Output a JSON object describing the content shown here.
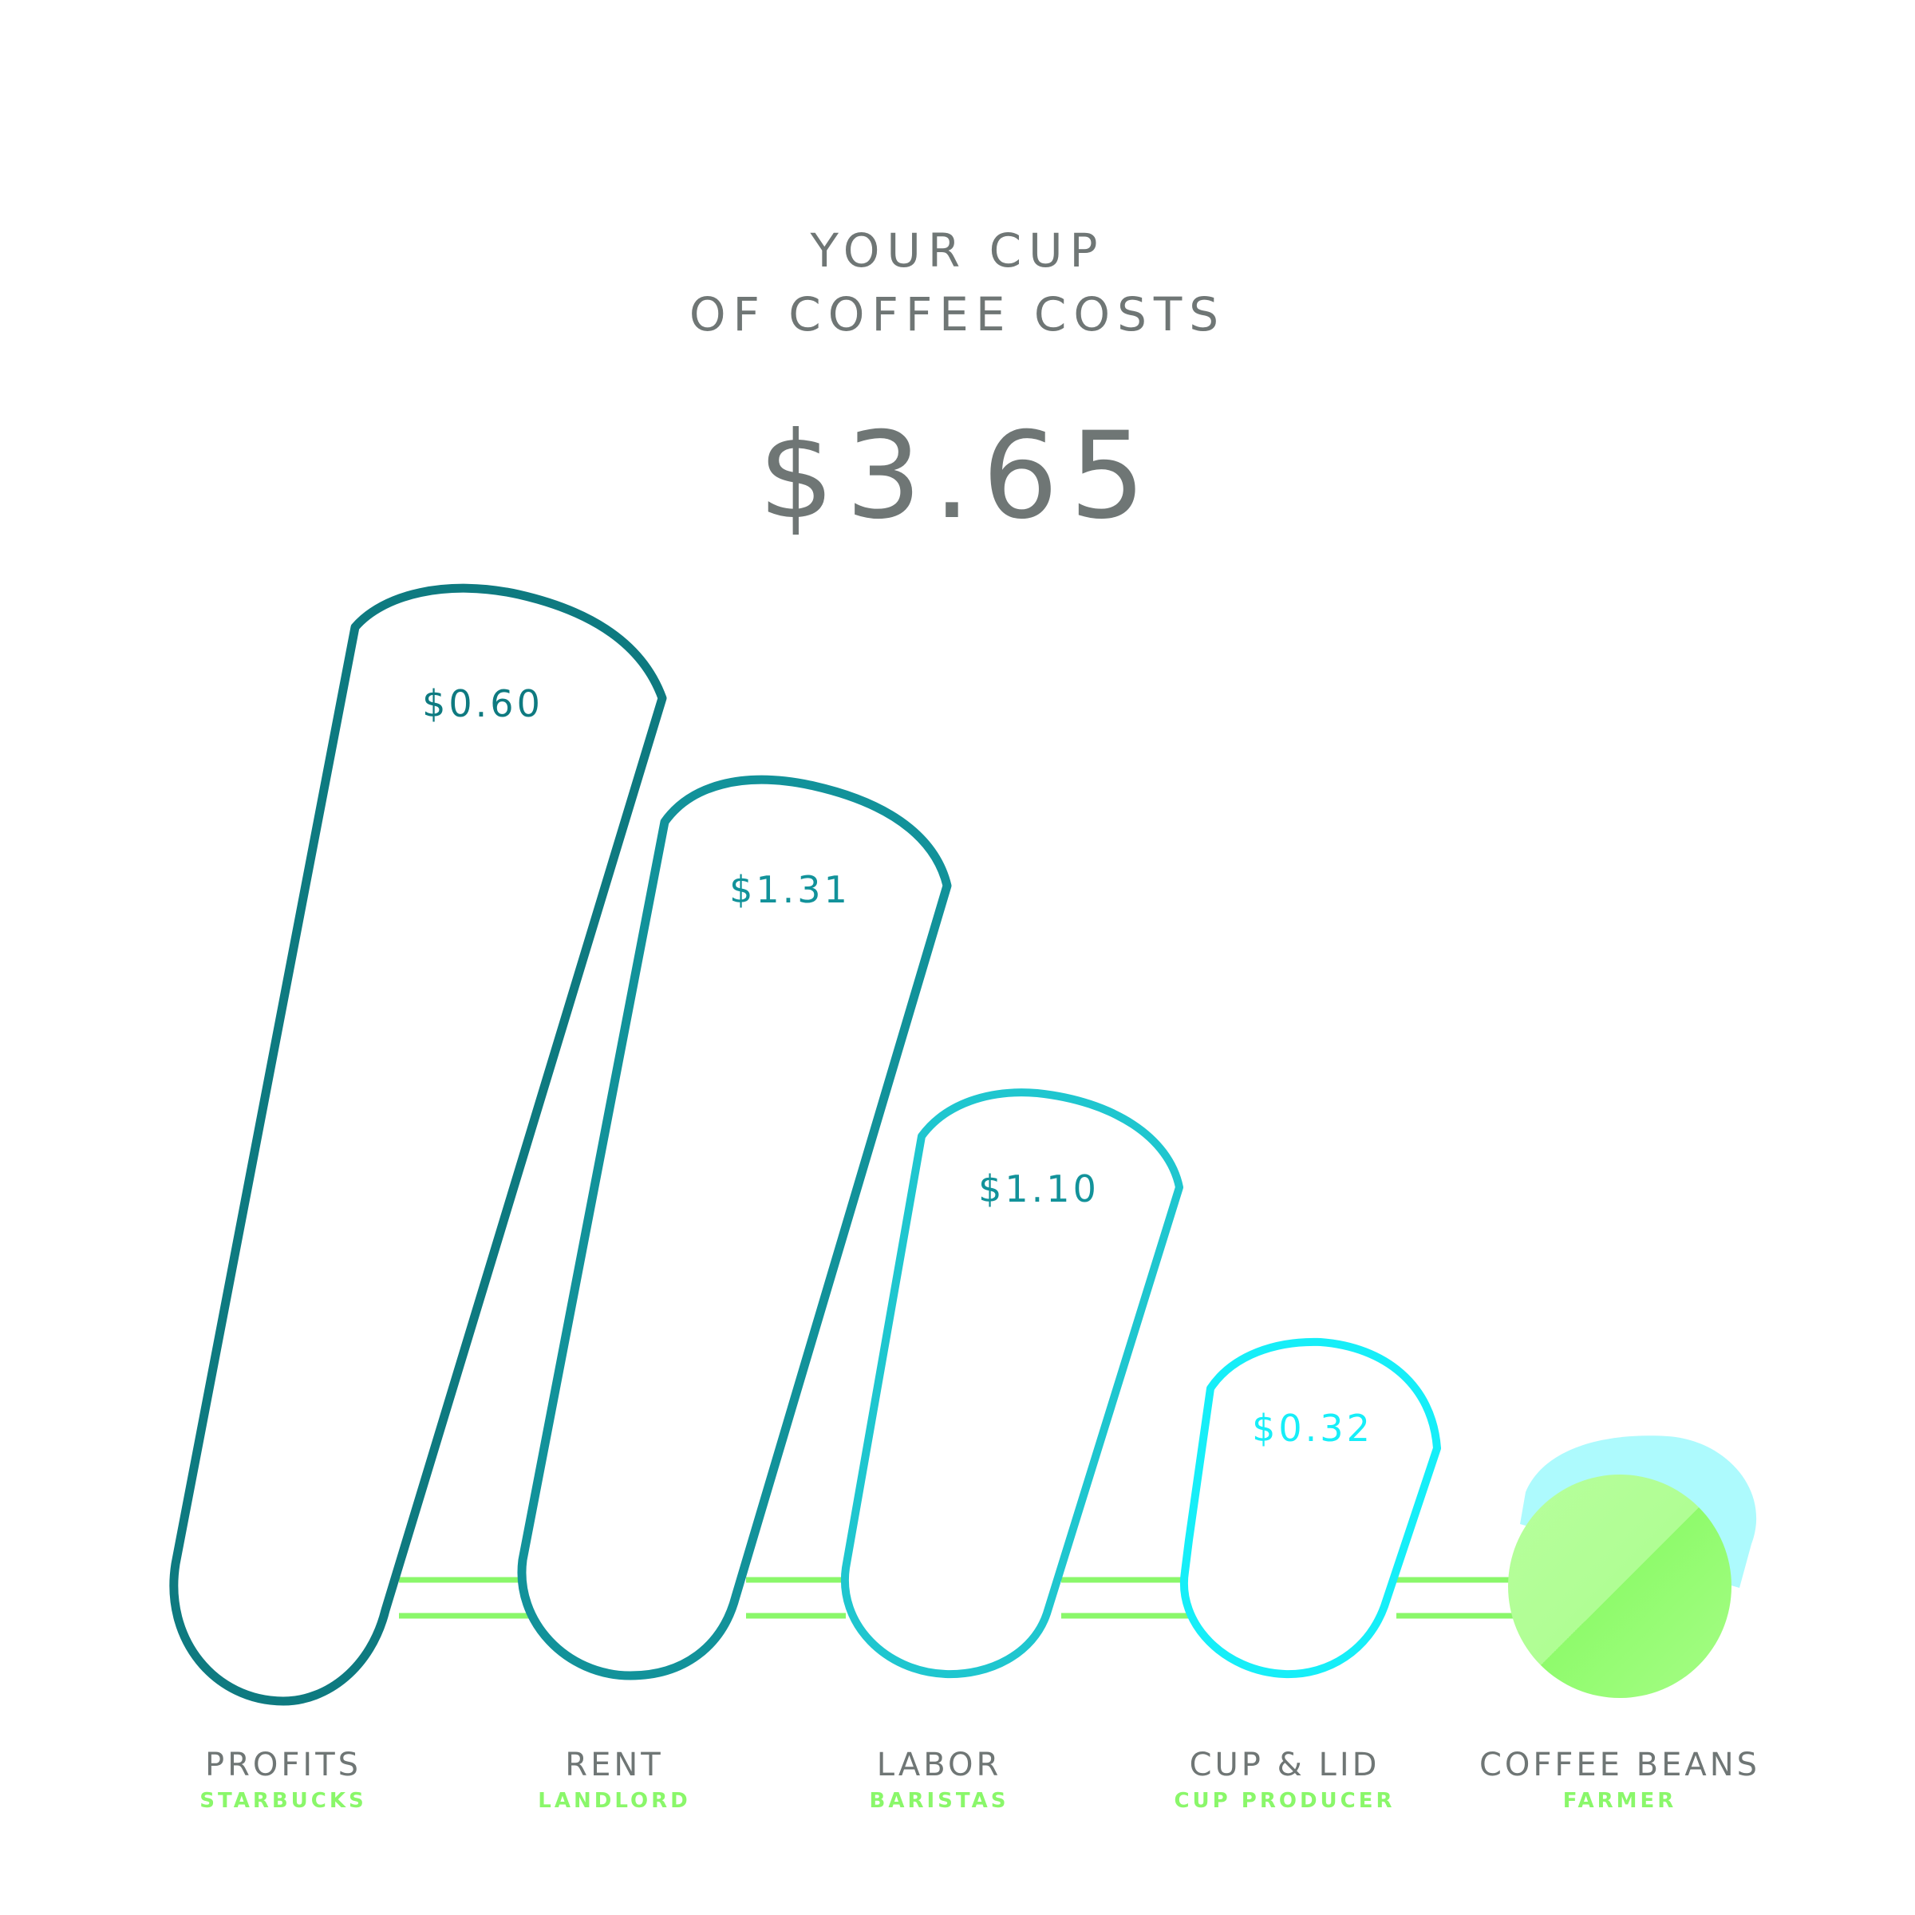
{
  "title_lines": [
    "YOUR CUP",
    "OF COFFEE COSTS"
  ],
  "total": "$3.65",
  "chart_data": {
    "type": "bar",
    "title": "YOUR CUP OF COFFEE COSTS",
    "total": 3.65,
    "categories": [
      "PROFITS",
      "RENT",
      "LABOR",
      "CUP & LID",
      "COFFEE BEANS"
    ],
    "subcategories": [
      "STARBUCKS",
      "LANDLORD",
      "BARISTAS",
      "CUP PRODUCER",
      "FARMER"
    ],
    "value_labels": [
      "$0.60",
      "$1.31",
      "$1.10",
      "$0.32",
      ""
    ],
    "values": [
      0.6,
      1.31,
      1.1,
      0.32,
      null
    ],
    "colors": [
      "#0e7a80",
      "#12929a",
      "#1fc6cf",
      "#16eef8",
      "#96fb73"
    ],
    "label_color": "#6f7675",
    "sublabel_color": "#8af76a",
    "connector_color": "#8af76a"
  }
}
